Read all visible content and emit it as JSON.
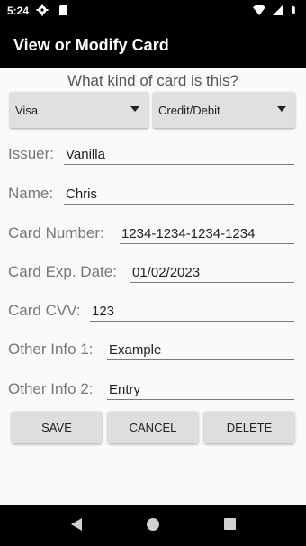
{
  "status_bar": {
    "time": "5:24",
    "left_icons": [
      "gear-icon",
      "sd-card-icon"
    ],
    "right_icons": [
      "wifi-icon",
      "signal-icon",
      "battery-icon"
    ]
  },
  "app_bar": {
    "title": "View or Modify Card"
  },
  "card_kind": {
    "question": "What kind of card is this?",
    "brand_selected": "Visa",
    "type_selected": "Credit/Debit"
  },
  "fields": {
    "issuer": {
      "label": "Issuer:",
      "value": "Vanilla"
    },
    "name": {
      "label": "Name:",
      "value": "Chris"
    },
    "card_number": {
      "label": "Card Number:",
      "value": "1234-1234-1234-1234"
    },
    "exp_date": {
      "label": "Card Exp. Date:",
      "value": "01/02/2023"
    },
    "cvv": {
      "label": "Card CVV:",
      "value": "123"
    },
    "other_info_1": {
      "label": "Other Info 1:",
      "value": "Example"
    },
    "other_info_2": {
      "label": "Other Info 2:",
      "value": "Entry"
    }
  },
  "buttons": {
    "save": "SAVE",
    "cancel": "CANCEL",
    "delete": "DELETE"
  },
  "nav_bar": {
    "icons": [
      "back-icon",
      "home-icon",
      "recents-icon"
    ]
  },
  "colors": {
    "bars": "#000000",
    "background": "#fafafa",
    "button": "#dedede"
  }
}
